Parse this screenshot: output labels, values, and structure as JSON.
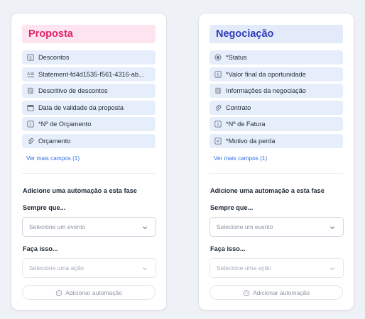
{
  "phases": [
    {
      "title": "Proposta",
      "title_bg": "#fde4ee",
      "title_color": "#e0266e",
      "fields": [
        {
          "icon": "currency-icon",
          "label": "Descontos"
        },
        {
          "icon": "text-format-icon",
          "label": "Statement-fd4d1535-f561-4316-ab..."
        },
        {
          "icon": "document-icon",
          "label": "Descritivo de descontos"
        },
        {
          "icon": "calendar-icon",
          "label": "Data de validade da proposta"
        },
        {
          "icon": "number-icon",
          "label": "*Nº de Orçamento"
        },
        {
          "icon": "attachment-icon",
          "label": "Orçamento"
        }
      ]
    },
    {
      "title": "Negociação",
      "title_bg": "#e3ebfb",
      "title_color": "#2f3db8",
      "fields": [
        {
          "icon": "radio-icon",
          "label": "*Status"
        },
        {
          "icon": "currency-icon",
          "label": "*Valor final da oportunidade"
        },
        {
          "icon": "document-icon",
          "label": "Informações da negociação"
        },
        {
          "icon": "attachment-icon",
          "label": "Contrato"
        },
        {
          "icon": "number-icon",
          "label": "*Nº de Fatura"
        },
        {
          "icon": "dropdown-icon",
          "label": "*Motivo da perda"
        }
      ]
    }
  ],
  "more_fields_label": "Ver mais campos (1)",
  "automation": {
    "title": "Adicione uma automação a esta fase",
    "when_label": "Sempre que...",
    "event_placeholder": "Selecione um evento",
    "do_label": "Faça isso...",
    "action_placeholder": "Selecione uma ação",
    "add_button_label": "Adicionar automação"
  },
  "colors": {
    "accent_link": "#2f6fe0",
    "field_bg": "#e6eefb",
    "page_bg": "#eef1f6"
  }
}
